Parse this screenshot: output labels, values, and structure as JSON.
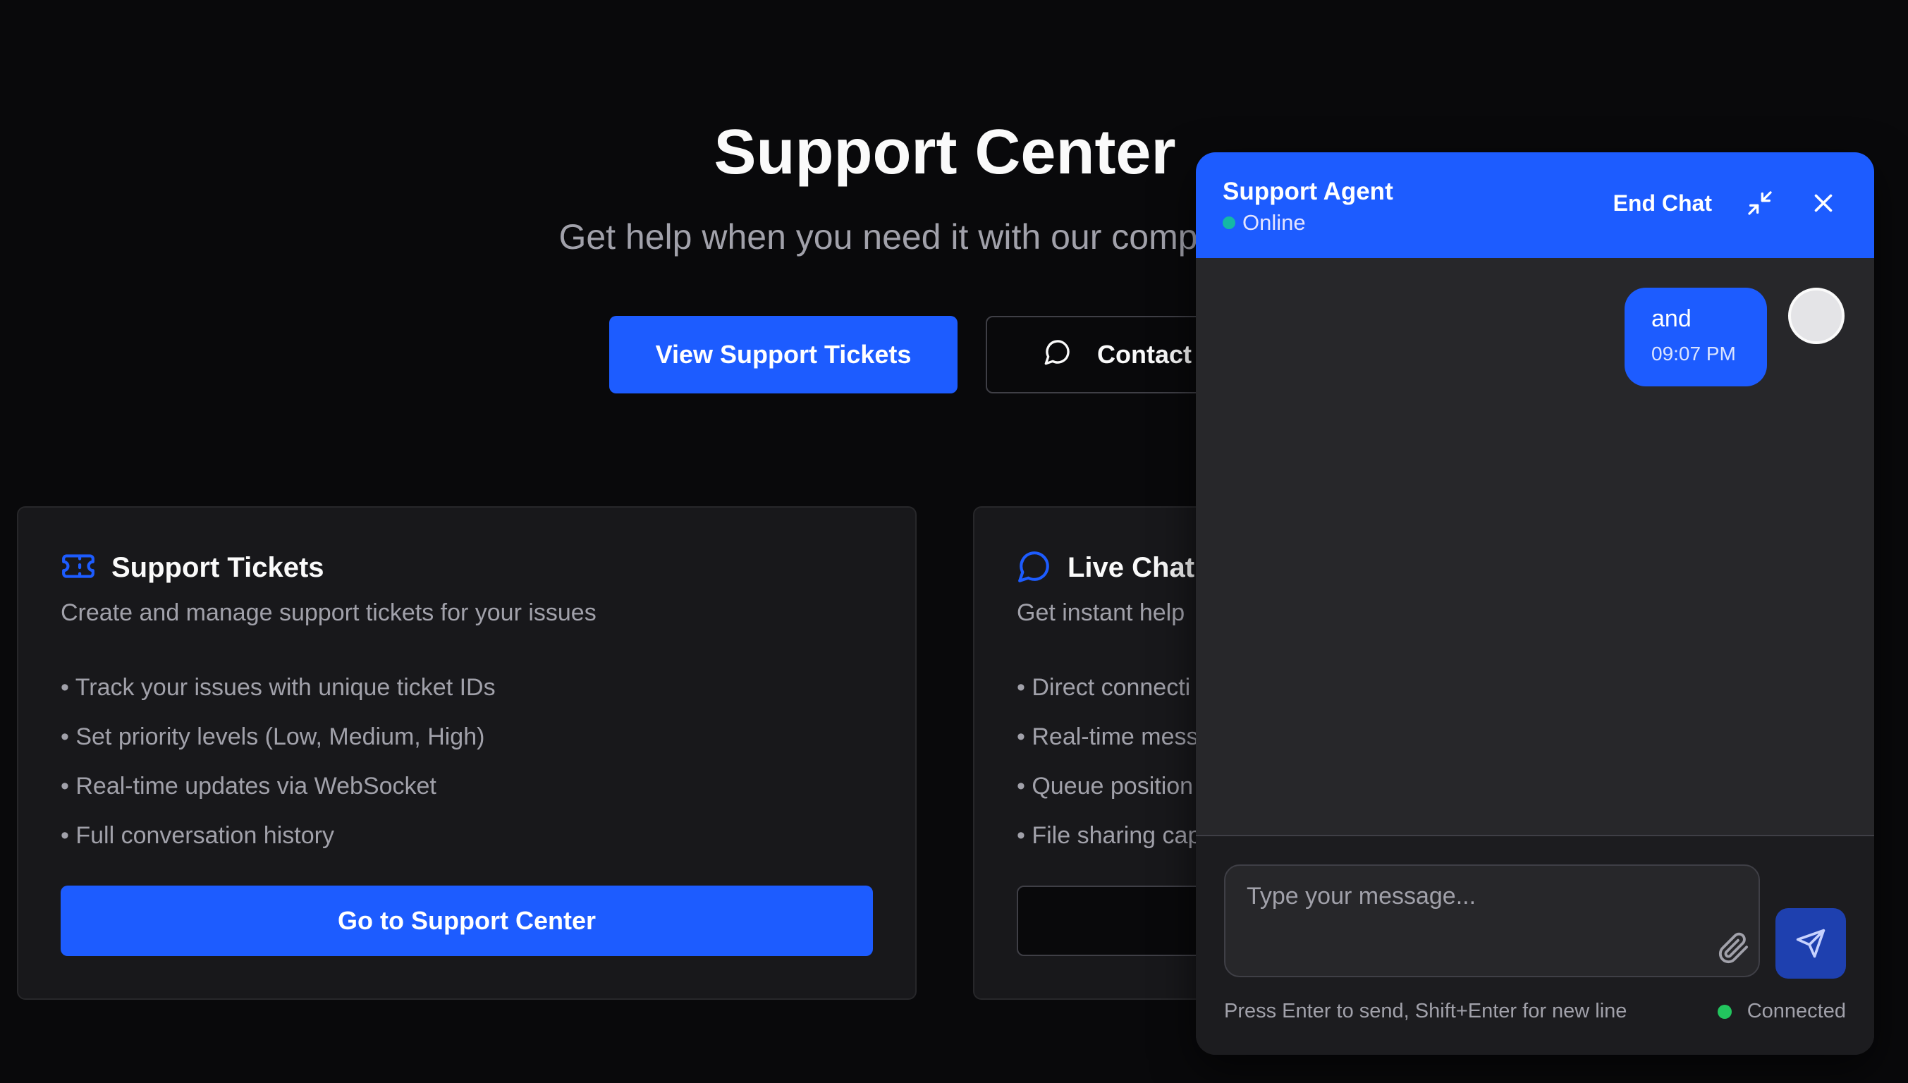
{
  "hero": {
    "title": "Support Center",
    "subtitle": "Get help when you need it with our comprehensiv",
    "primary_button": "View Support Tickets",
    "secondary_button": "Contact"
  },
  "cards": [
    {
      "title": "Support Tickets",
      "icon": "ticket-icon",
      "description": "Create and manage support tickets for your issues",
      "features": [
        "• Track your issues with unique ticket IDs",
        "• Set priority levels (Low, Medium, High)",
        "• Real-time updates via WebSocket",
        "• Full conversation history"
      ],
      "button": "Go to Support Center"
    },
    {
      "title": "Live Chat",
      "icon": "chat-bubble-icon",
      "description": "Get instant help",
      "features": [
        "• Direct connecti",
        "• Real-time mess",
        "• Queue position",
        "• File sharing cap"
      ],
      "button": ""
    }
  ],
  "chat": {
    "agent_name": "Support Agent",
    "agent_status": "Online",
    "end_chat": "End Chat",
    "messages": [
      {
        "text": "and",
        "time": "09:07 PM"
      }
    ],
    "input_placeholder": "Type your message...",
    "hint": "Press Enter to send, Shift+Enter for new line",
    "connection": "Connected"
  },
  "colors": {
    "background": "#09090b",
    "accent": "#1d5cff",
    "card": "#18181b",
    "online": "#14b8a6",
    "connected": "#22c55e"
  }
}
